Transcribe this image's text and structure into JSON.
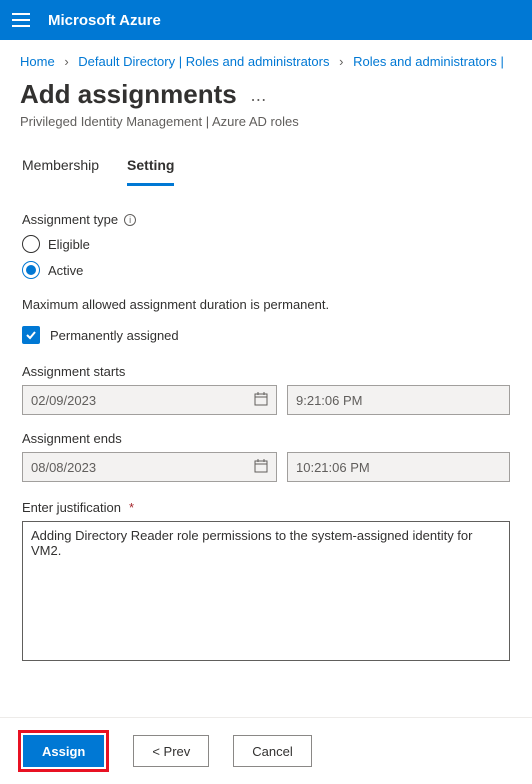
{
  "header": {
    "brand": "Microsoft Azure"
  },
  "breadcrumb": {
    "home": "Home",
    "dir": "Default Directory | Roles and administrators",
    "roles": "Roles and administrators |"
  },
  "title": {
    "heading": "Add assignments",
    "subtitle": "Privileged Identity Management | Azure AD roles"
  },
  "tabs": {
    "membership": "Membership",
    "setting": "Setting"
  },
  "form": {
    "assignment_type_label": "Assignment type",
    "eligible": "Eligible",
    "active": "Active",
    "max_duration_text": "Maximum allowed assignment duration is permanent.",
    "permanently_assigned": "Permanently assigned",
    "assignment_starts_label": "Assignment starts",
    "start_date": "02/09/2023",
    "start_time": "9:21:06 PM",
    "assignment_ends_label": "Assignment ends",
    "end_date": "08/08/2023",
    "end_time": "10:21:06 PM",
    "justification_label": "Enter justification",
    "justification_value": "Adding Directory Reader role permissions to the system-assigned identity for VM2."
  },
  "footer": {
    "assign": "Assign",
    "prev": "<  Prev",
    "cancel": "Cancel"
  }
}
